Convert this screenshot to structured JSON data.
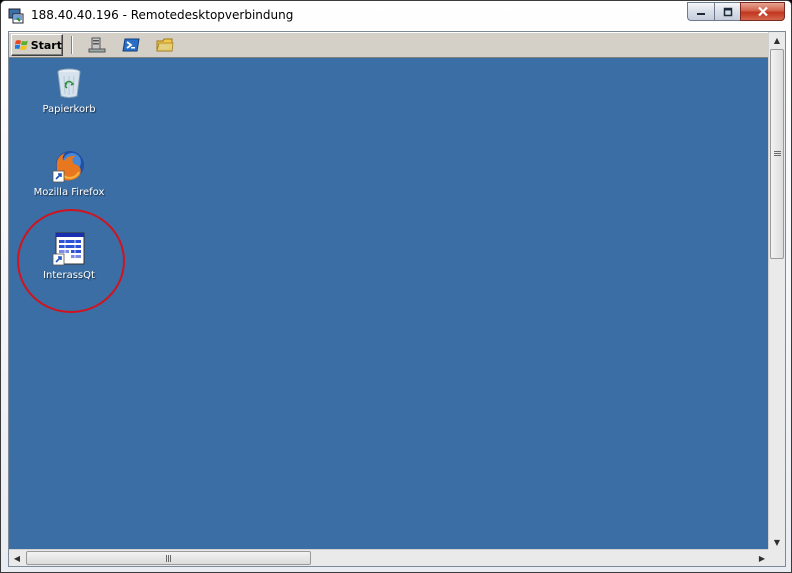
{
  "window": {
    "title": "188.40.40.196 - Remotedesktopverbindung",
    "icons": {
      "app": "remote-desktop-icon",
      "minimize": "minimize-icon",
      "maximize": "maximize-icon",
      "close": "close-icon"
    }
  },
  "taskbar": {
    "start_label": "Start",
    "quick_launch": [
      "server-manager-icon",
      "powershell-icon",
      "explorer-folder-icon"
    ]
  },
  "desktop": {
    "background_color": "#3a6ea5",
    "icons": [
      {
        "label": "Papierkorb",
        "icon": "recycle-bin-icon"
      },
      {
        "label": "Mozilla Firefox",
        "icon": "firefox-icon"
      },
      {
        "label": "InterassQt",
        "icon": "interassqt-icon"
      }
    ],
    "highlight_color": "#d0141e"
  },
  "scrollbars": {
    "vertical_position": 0,
    "horizontal_position": 0
  }
}
